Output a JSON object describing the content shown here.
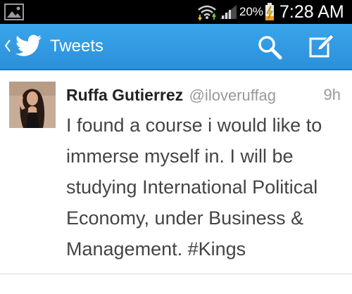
{
  "status_bar": {
    "battery_percent": "20%",
    "time": "7:28 AM",
    "icons": [
      "gallery-icon",
      "wifi-icon",
      "signal-icon",
      "battery-charging-icon"
    ]
  },
  "action_bar": {
    "title": "Tweets",
    "background_color": "#2b8fd9",
    "icons": [
      "back-chevron-icon",
      "twitter-bird-icon",
      "search-icon",
      "compose-icon"
    ]
  },
  "tweet": {
    "author_name": "Ruffa Gutierrez",
    "author_handle": "@iloveruffag",
    "time_ago": "9h",
    "text": "I found a course i would like to immerse myself in. I will be studying International Political Economy, under Business & Management. #Kings"
  }
}
